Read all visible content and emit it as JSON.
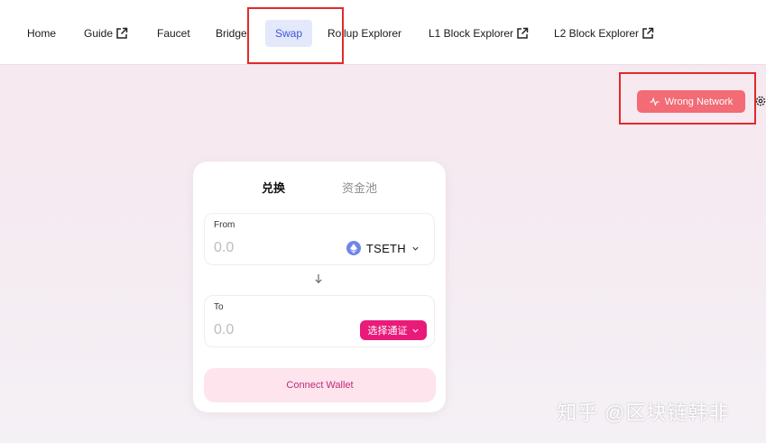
{
  "nav": {
    "items": [
      {
        "label": "Home",
        "external": false
      },
      {
        "label": "Guide",
        "external": true
      },
      {
        "label": "Faucet",
        "external": false
      },
      {
        "label": "Bridge",
        "external": false
      },
      {
        "label": "Swap",
        "external": false,
        "active": true
      },
      {
        "label": "Rollup Explorer",
        "external": false
      },
      {
        "label": "L1 Block Explorer",
        "external": true
      },
      {
        "label": "L2 Block Explorer",
        "external": true
      }
    ]
  },
  "network": {
    "status_label": "Wrong Network"
  },
  "swap_card": {
    "tabs": [
      "兑换",
      "资金池"
    ],
    "active_tab": "兑换",
    "from": {
      "label": "From",
      "amount_placeholder": "0.0",
      "token": "TSETH"
    },
    "to": {
      "label": "To",
      "amount_placeholder": "0.0",
      "select_token_label": "选择通证"
    },
    "connect_label": "Connect Wallet"
  },
  "watermark": "知乎 @区块链韩非",
  "colors": {
    "accent": "#ea1a7a",
    "active_tab_bg": "#e4e8fb",
    "active_tab_text": "#3e57d8",
    "wrong_network": "#f26b75",
    "connect_bg": "#fde4ed",
    "highlight_box": "#e22a2a"
  },
  "icons": {
    "external": "external-link-icon",
    "network": "activity-pulse-icon",
    "settings": "gear-icon",
    "token": "ethereum-icon",
    "chevron": "chevron-down-icon",
    "arrow": "arrow-down-icon"
  }
}
